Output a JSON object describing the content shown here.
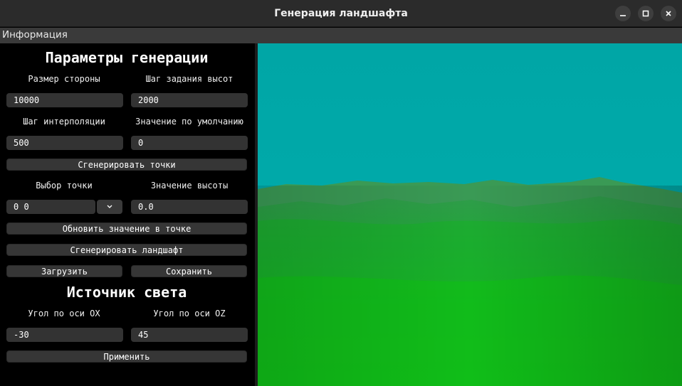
{
  "window": {
    "title": "Генерация ландшафта"
  },
  "menu": {
    "info": "Информация"
  },
  "generation": {
    "heading": "Параметры генерации",
    "side_size_label": "Размер стороны",
    "side_size_value": "10000",
    "height_step_label": "Шаг задания высот",
    "height_step_value": "2000",
    "interp_step_label": "Шаг интерполяции",
    "interp_step_value": "500",
    "default_value_label": "Значение по умолчанию",
    "default_value_value": "0",
    "generate_points_button": "Сгенерировать точки",
    "point_select_label": "Выбор точки",
    "point_select_value": "0 0",
    "height_value_label": "Значение высоты",
    "height_value_value": "0.0",
    "update_point_button": "Обновить значение в точке",
    "generate_landscape_button": "Сгенерировать ландшафт",
    "load_button": "Загрузить",
    "save_button": "Сохранить"
  },
  "light": {
    "heading": "Источник света",
    "angle_ox_label": "Угол по оси OX",
    "angle_ox_value": "-30",
    "angle_oz_label": "Угол по оси OZ",
    "angle_oz_value": "45",
    "apply_button": "Применить"
  },
  "icons": {
    "minimize": "minimize-icon",
    "maximize": "maximize-icon",
    "close": "close-icon",
    "dropdown": "chevron-down-icon"
  },
  "colors": {
    "sky": "#00a8a8",
    "terrain_far": "#2fa04a",
    "terrain_near": "#10c010"
  }
}
